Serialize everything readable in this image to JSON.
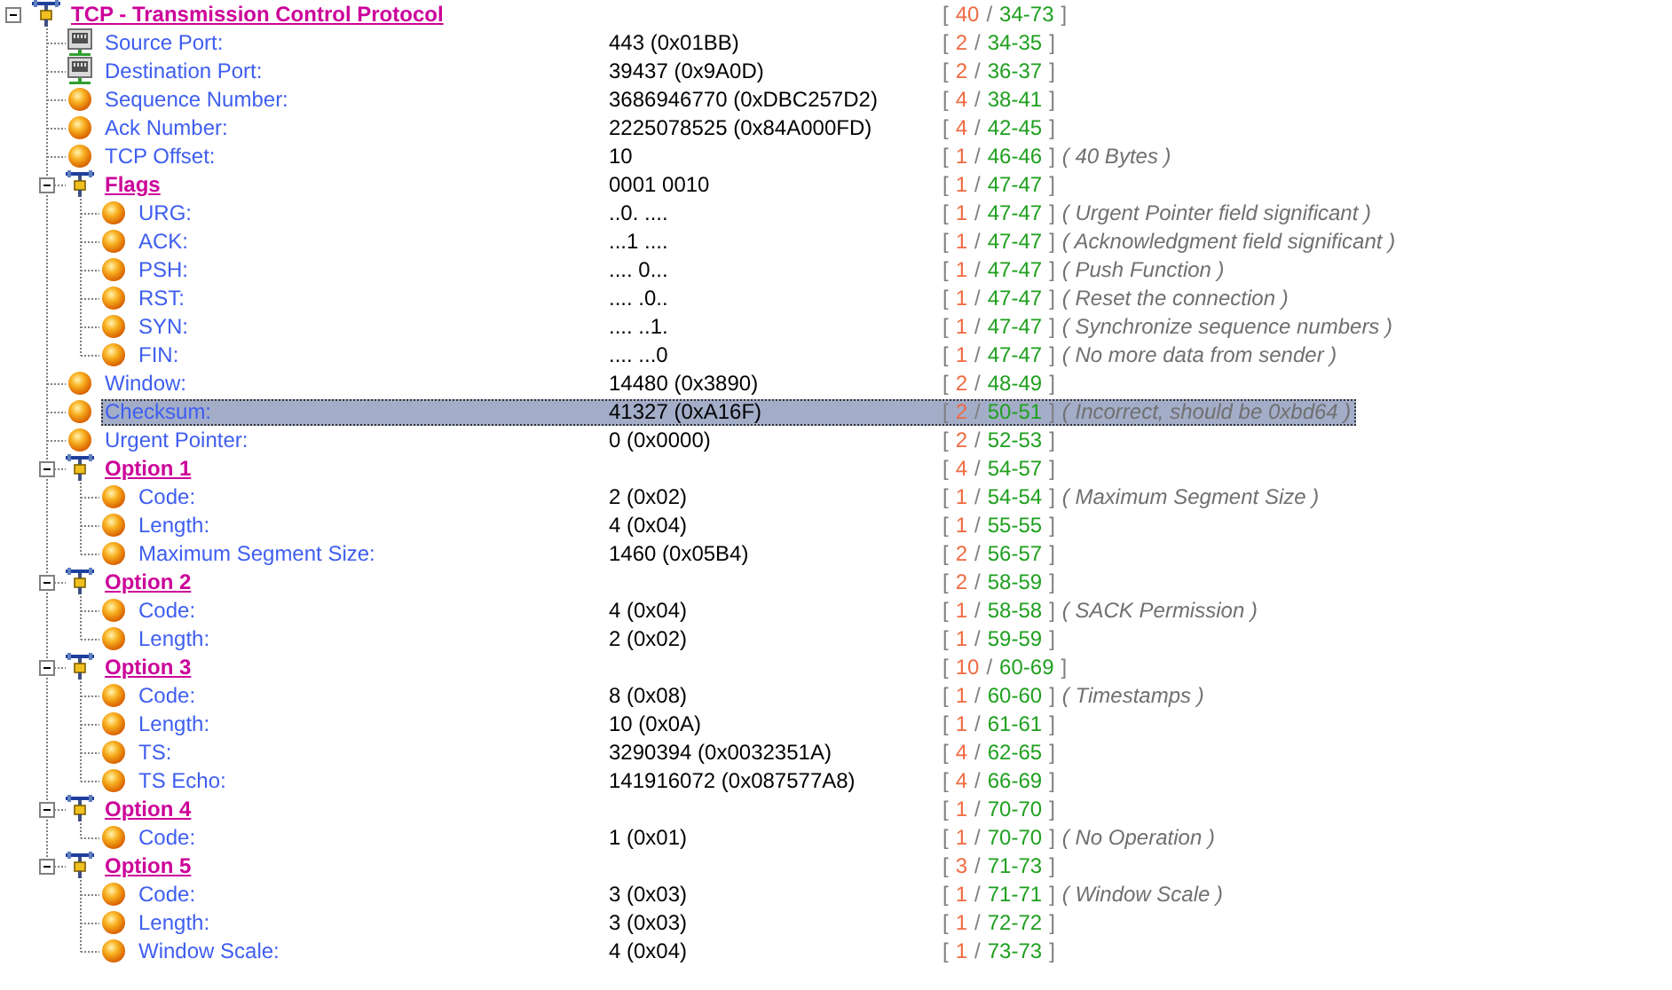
{
  "tree": {
    "kind": "group",
    "label": "TCP - Transmission Control Protocol",
    "bytes": [
      "[",
      "40",
      "/",
      "34-73",
      "]"
    ],
    "expanded": true,
    "selected": false,
    "children": [
      {
        "kind": "port",
        "label": "Source Port:",
        "value": "443 (0x01BB)",
        "bytes": [
          "[",
          "2",
          "/",
          "34-35",
          "]"
        ],
        "selected": false
      },
      {
        "kind": "port",
        "label": "Destination Port:",
        "value": "39437 (0x9A0D)",
        "bytes": [
          "[",
          "2",
          "/",
          "36-37",
          "]"
        ],
        "selected": false
      },
      {
        "kind": "field",
        "label": "Sequence Number:",
        "value": "3686946770 (0xDBC257D2)",
        "bytes": [
          "[",
          "4",
          "/",
          "38-41",
          "]"
        ],
        "selected": false
      },
      {
        "kind": "field",
        "label": "Ack Number:",
        "value": "2225078525 (0x84A000FD)",
        "bytes": [
          "[",
          "4",
          "/",
          "42-45",
          "]"
        ],
        "selected": false
      },
      {
        "kind": "field",
        "label": "TCP Offset:",
        "value": "10",
        "bytes": [
          "[",
          "1",
          "/",
          "46-46",
          "]"
        ],
        "note": "( 40 Bytes )",
        "selected": false
      },
      {
        "kind": "group",
        "label": "Flags",
        "value": "0001 0010",
        "bytes": [
          "[",
          "1",
          "/",
          "47-47",
          "]"
        ],
        "expanded": true,
        "selected": false,
        "children": [
          {
            "kind": "field",
            "label": "URG:",
            "value": "..0. ....",
            "bytes": [
              "[",
              "1",
              "/",
              "47-47",
              "]"
            ],
            "note": "( Urgent Pointer field significant )",
            "selected": false
          },
          {
            "kind": "field",
            "label": "ACK:",
            "value": "...1 ....",
            "bytes": [
              "[",
              "1",
              "/",
              "47-47",
              "]"
            ],
            "note": "( Acknowledgment field significant )",
            "selected": false
          },
          {
            "kind": "field",
            "label": "PSH:",
            "value": ".... 0...",
            "bytes": [
              "[",
              "1",
              "/",
              "47-47",
              "]"
            ],
            "note": "( Push Function )",
            "selected": false
          },
          {
            "kind": "field",
            "label": "RST:",
            "value": ".... .0..",
            "bytes": [
              "[",
              "1",
              "/",
              "47-47",
              "]"
            ],
            "note": "( Reset the connection )",
            "selected": false
          },
          {
            "kind": "field",
            "label": "SYN:",
            "value": ".... ..1.",
            "bytes": [
              "[",
              "1",
              "/",
              "47-47",
              "]"
            ],
            "note": "( Synchronize sequence numbers )",
            "selected": false
          },
          {
            "kind": "field",
            "label": "FIN:",
            "value": ".... ...0",
            "bytes": [
              "[",
              "1",
              "/",
              "47-47",
              "]"
            ],
            "note": "( No more data from sender )",
            "selected": false
          }
        ]
      },
      {
        "kind": "field",
        "label": "Window:",
        "value": "14480 (0x3890)",
        "bytes": [
          "[",
          "2",
          "/",
          "48-49",
          "]"
        ],
        "selected": false
      },
      {
        "kind": "field",
        "label": "Checksum:",
        "value": "41327 (0xA16F)",
        "bytes": [
          "[",
          "2",
          "/",
          "50-51",
          "]"
        ],
        "note": "( Incorrect, should be 0xbd64 )",
        "selected": true
      },
      {
        "kind": "field",
        "label": "Urgent Pointer:",
        "value": "0 (0x0000)",
        "bytes": [
          "[",
          "2",
          "/",
          "52-53",
          "]"
        ],
        "selected": false
      },
      {
        "kind": "group",
        "label": "Option 1",
        "bytes": [
          "[",
          "4",
          "/",
          "54-57",
          "]"
        ],
        "expanded": true,
        "selected": false,
        "children": [
          {
            "kind": "field",
            "label": "Code:",
            "value": "2 (0x02)",
            "bytes": [
              "[",
              "1",
              "/",
              "54-54",
              "]"
            ],
            "note": "( Maximum Segment Size )",
            "selected": false
          },
          {
            "kind": "field",
            "label": "Length:",
            "value": "4 (0x04)",
            "bytes": [
              "[",
              "1",
              "/",
              "55-55",
              "]"
            ],
            "selected": false
          },
          {
            "kind": "field",
            "label": "Maximum Segment Size:",
            "value": "1460 (0x05B4)",
            "bytes": [
              "[",
              "2",
              "/",
              "56-57",
              "]"
            ],
            "selected": false
          }
        ]
      },
      {
        "kind": "group",
        "label": "Option 2",
        "bytes": [
          "[",
          "2",
          "/",
          "58-59",
          "]"
        ],
        "expanded": true,
        "selected": false,
        "children": [
          {
            "kind": "field",
            "label": "Code:",
            "value": "4 (0x04)",
            "bytes": [
              "[",
              "1",
              "/",
              "58-58",
              "]"
            ],
            "note": "( SACK Permission )",
            "selected": false
          },
          {
            "kind": "field",
            "label": "Length:",
            "value": "2 (0x02)",
            "bytes": [
              "[",
              "1",
              "/",
              "59-59",
              "]"
            ],
            "selected": false
          }
        ]
      },
      {
        "kind": "group",
        "label": "Option 3",
        "bytes": [
          "[",
          "10",
          "/",
          "60-69",
          "]"
        ],
        "expanded": true,
        "selected": false,
        "children": [
          {
            "kind": "field",
            "label": "Code:",
            "value": "8 (0x08)",
            "bytes": [
              "[",
              "1",
              "/",
              "60-60",
              "]"
            ],
            "note": "( Timestamps )",
            "selected": false
          },
          {
            "kind": "field",
            "label": "Length:",
            "value": "10 (0x0A)",
            "bytes": [
              "[",
              "1",
              "/",
              "61-61",
              "]"
            ],
            "selected": false
          },
          {
            "kind": "field",
            "label": "TS:",
            "value": "3290394 (0x0032351A)",
            "bytes": [
              "[",
              "4",
              "/",
              "62-65",
              "]"
            ],
            "selected": false
          },
          {
            "kind": "field",
            "label": "TS Echo:",
            "value": "141916072 (0x087577A8)",
            "bytes": [
              "[",
              "4",
              "/",
              "66-69",
              "]"
            ],
            "selected": false
          }
        ]
      },
      {
        "kind": "group",
        "label": "Option 4",
        "bytes": [
          "[",
          "1",
          "/",
          "70-70",
          "]"
        ],
        "expanded": true,
        "selected": false,
        "children": [
          {
            "kind": "field",
            "label": "Code:",
            "value": "1 (0x01)",
            "bytes": [
              "[",
              "1",
              "/",
              "70-70",
              "]"
            ],
            "note": "( No Operation )",
            "selected": false
          }
        ]
      },
      {
        "kind": "group",
        "label": "Option 5",
        "bytes": [
          "[",
          "3",
          "/",
          "71-73",
          "]"
        ],
        "expanded": true,
        "selected": false,
        "children": [
          {
            "kind": "field",
            "label": "Code:",
            "value": "3 (0x03)",
            "bytes": [
              "[",
              "1",
              "/",
              "71-71",
              "]"
            ],
            "note": "( Window Scale )",
            "selected": false
          },
          {
            "kind": "field",
            "label": "Length:",
            "value": "3 (0x03)",
            "bytes": [
              "[",
              "1",
              "/",
              "72-72",
              "]"
            ],
            "selected": false
          },
          {
            "kind": "field",
            "label": "Window Scale:",
            "value": "4 (0x04)",
            "bytes": [
              "[",
              "1",
              "/",
              "73-73",
              "]"
            ],
            "selected": false
          }
        ]
      }
    ]
  }
}
